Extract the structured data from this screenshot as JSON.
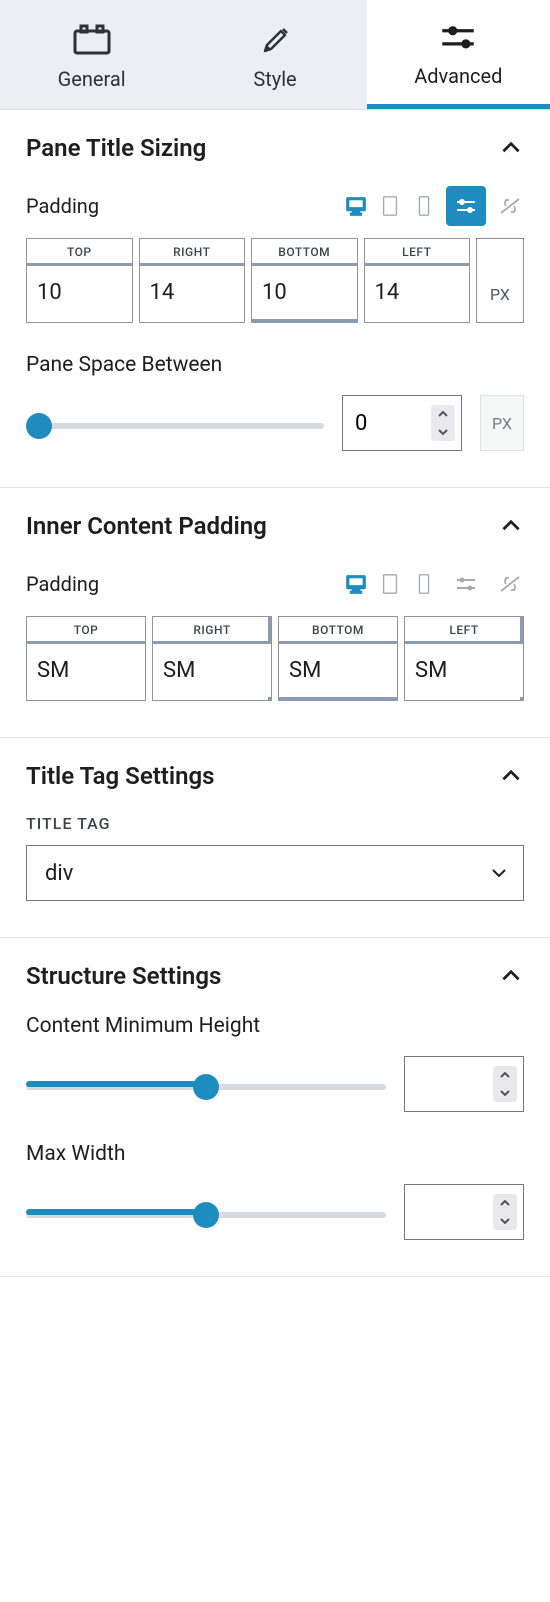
{
  "tabs": {
    "general": "General",
    "style": "Style",
    "advanced": "Advanced"
  },
  "sections": {
    "pane_title_sizing": {
      "title": "Pane Title Sizing",
      "padding_label": "Padding",
      "padding": {
        "top_label": "TOP",
        "right_label": "RIGHT",
        "bottom_label": "BOTTOM",
        "left_label": "LEFT",
        "top": "10",
        "right": "14",
        "bottom": "10",
        "left": "14",
        "unit": "PX"
      },
      "space_between": {
        "label": "Pane Space Between",
        "value": "0",
        "unit": "PX"
      }
    },
    "inner_content_padding": {
      "title": "Inner Content Padding",
      "padding_label": "Padding",
      "padding": {
        "top_label": "TOP",
        "right_label": "RIGHT",
        "bottom_label": "BOTTOM",
        "left_label": "LEFT",
        "top": "SM",
        "right": "SM",
        "bottom": "SM",
        "left": "SM"
      }
    },
    "title_tag": {
      "title": "Title Tag Settings",
      "label": "TITLE TAG",
      "value": "div"
    },
    "structure": {
      "title": "Structure Settings",
      "content_min_height": {
        "label": "Content Minimum Height",
        "value": ""
      },
      "max_width": {
        "label": "Max Width",
        "value": ""
      }
    }
  }
}
